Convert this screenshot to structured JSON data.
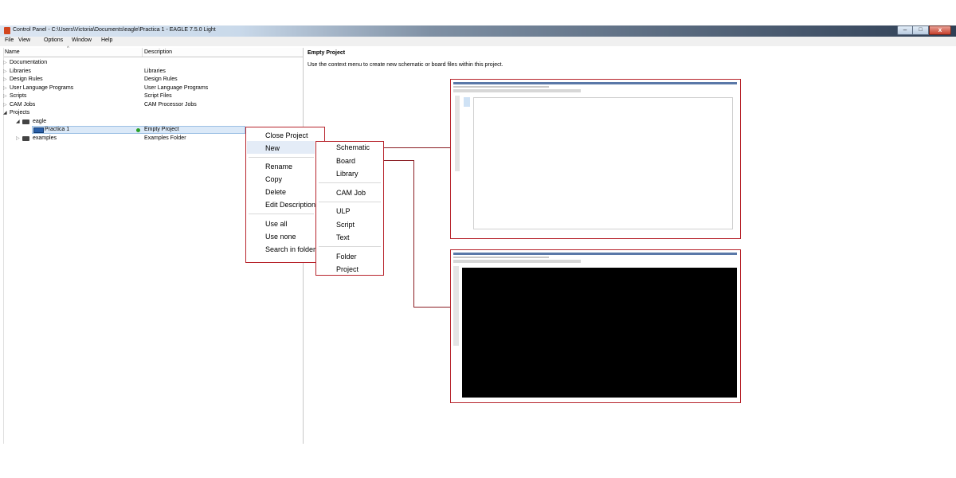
{
  "window": {
    "title": "Control Panel - C:\\Users\\Victoria\\Documents\\eagle\\Practica 1 - EAGLE 7.5.0 Light",
    "minimize": "–",
    "maximize": "□",
    "close": "x"
  },
  "menubar": [
    "File",
    "View",
    "Options",
    "Window",
    "Help"
  ],
  "tree": {
    "headers": {
      "name": "Name",
      "description": "Description"
    },
    "rows": [
      {
        "name": "Documentation",
        "description": ""
      },
      {
        "name": "Libraries",
        "description": "Libraries"
      },
      {
        "name": "Design Rules",
        "description": "Design Rules"
      },
      {
        "name": "User Language Programs",
        "description": "User Language Programs"
      },
      {
        "name": "Scripts",
        "description": "Script Files"
      },
      {
        "name": "CAM Jobs",
        "description": "CAM Processor Jobs"
      },
      {
        "name": "Projects",
        "description": ""
      },
      {
        "name": "eagle",
        "description": ""
      },
      {
        "name": "Practica 1",
        "description": "Empty Project"
      },
      {
        "name": "examples",
        "description": "Examples Folder"
      }
    ]
  },
  "right_pane": {
    "title": "Empty Project",
    "description": "Use the context menu to create new schematic or board files within this project."
  },
  "context_menu": {
    "items": [
      "Close Project",
      "New",
      "Rename",
      "Copy",
      "Delete",
      "Edit Description",
      "Use all",
      "Use none",
      "Search in folder"
    ]
  },
  "submenu": {
    "items": [
      "Schematic",
      "Board",
      "Library",
      "CAM Job",
      "ULP",
      "Script",
      "Text",
      "Folder",
      "Project"
    ]
  },
  "colors": {
    "highlight_border": "#b7242c",
    "board_background": "#000000",
    "selection": "#dbe9f8"
  }
}
